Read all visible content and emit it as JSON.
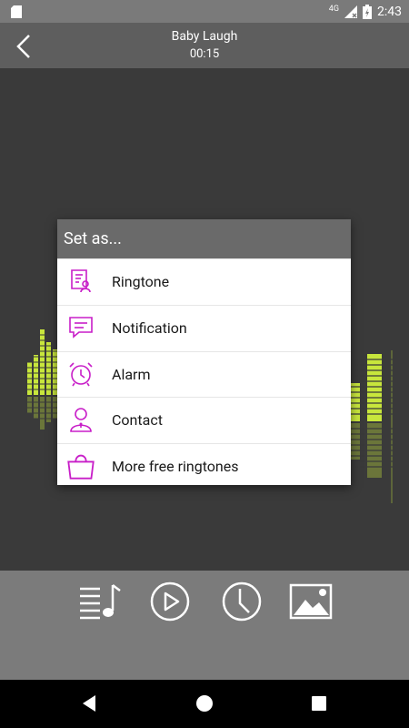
{
  "status_bar": {
    "network": "4G",
    "time": "2:43"
  },
  "app_bar": {
    "title": "Baby Laugh",
    "duration": "00:15",
    "back_icon": "chevron-left-icon"
  },
  "colors": {
    "accent": "#c81ec8",
    "equalizer": "#c8e63c",
    "dialog_header": "#6a6a6a",
    "controls_bg": "#7b7b7b",
    "stage_bg": "#3a3a3a"
  },
  "dialog": {
    "title": "Set as...",
    "options": [
      {
        "label": "Ringtone",
        "icon": "ringtone-doc-icon"
      },
      {
        "label": "Notification",
        "icon": "chat-bubble-icon"
      },
      {
        "label": "Alarm",
        "icon": "alarm-clock-icon"
      },
      {
        "label": "Contact",
        "icon": "contact-person-icon"
      },
      {
        "label": "More free ringtones",
        "icon": "shopping-bag-icon"
      }
    ]
  },
  "controls": [
    {
      "name": "playlist",
      "icon": "playlist-music-icon"
    },
    {
      "name": "play",
      "icon": "play-icon"
    },
    {
      "name": "timer",
      "icon": "clock-icon"
    },
    {
      "name": "wallpaper",
      "icon": "image-icon"
    }
  ],
  "nav": [
    {
      "name": "back",
      "icon": "nav-back-icon"
    },
    {
      "name": "home",
      "icon": "nav-home-icon"
    },
    {
      "name": "recents",
      "icon": "nav-recents-icon"
    }
  ]
}
